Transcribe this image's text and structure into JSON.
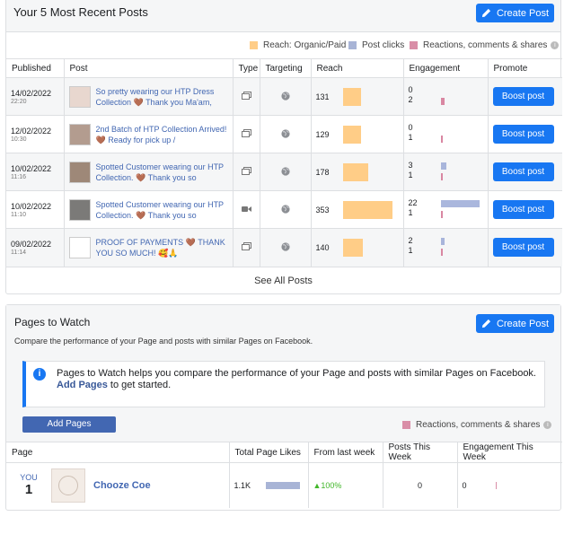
{
  "recent": {
    "title": "Your 5 Most Recent Posts",
    "create_post": "Create Post",
    "legend": [
      {
        "label": "Reach: Organic/Paid",
        "color": "#ffcd87"
      },
      {
        "label": "Post clicks",
        "color": "#a8b4d6"
      },
      {
        "label": "Reactions, comments & shares",
        "color": "#d98ea7"
      }
    ],
    "info_icon": "info-icon",
    "columns": [
      "Published",
      "Post",
      "Type",
      "Targeting",
      "Reach",
      "Engagement",
      "Promote"
    ],
    "rows": [
      {
        "date": "14/02/2022",
        "time": "22:20",
        "text": "So pretty wearing our HTP Dress Collection 🤎 Thank you Ma'am,",
        "type": "photo",
        "reach": "131",
        "reach_frac": 0.37,
        "eng1": "0",
        "eng2": "2",
        "eng1_frac": 0,
        "eng2_frac": 0.09,
        "boost": "Boost post"
      },
      {
        "date": "12/02/2022",
        "time": "10:30",
        "text": "2nd Batch of HTP Collection Arrived! 🤎 Ready for pick up /",
        "type": "photo",
        "reach": "129",
        "reach_frac": 0.37,
        "eng1": "0",
        "eng2": "1",
        "eng1_frac": 0,
        "eng2_frac": 0.045,
        "boost": "Boost post"
      },
      {
        "date": "10/02/2022",
        "time": "11:16",
        "text": "Spotted Customer wearing our HTP Collection. 🤎 Thank you so",
        "type": "photo",
        "reach": "178",
        "reach_frac": 0.5,
        "eng1": "3",
        "eng2": "1",
        "eng1_frac": 0.14,
        "eng2_frac": 0.045,
        "boost": "Boost post"
      },
      {
        "date": "10/02/2022",
        "time": "11:10",
        "text": "Spotted Customer wearing our HTP Collection. 🤎 Thank you so",
        "type": "video",
        "reach": "353",
        "reach_frac": 1.0,
        "eng1": "22",
        "eng2": "1",
        "eng1_frac": 1.0,
        "eng2_frac": 0.045,
        "boost": "Boost post"
      },
      {
        "date": "09/02/2022",
        "time": "11:14",
        "text": "PROOF OF PAYMENTS 🤎 THANK YOU SO MUCH! 🥰🙏",
        "type": "photo",
        "reach": "140",
        "reach_frac": 0.4,
        "eng1": "2",
        "eng2": "1",
        "eng1_frac": 0.09,
        "eng2_frac": 0.045,
        "boost": "Boost post"
      }
    ],
    "see_all": "See All Posts"
  },
  "watch": {
    "title": "Pages to Watch",
    "create_post": "Create Post",
    "subtitle": "Compare the performance of your Page and posts with similar Pages on Facebook.",
    "info_text": "Pages to Watch helps you compare the performance of your Page and posts with similar Pages on Facebook.",
    "info_link": "Add Pages",
    "info_suffix": " to get started.",
    "add_pages": "Add Pages",
    "legend": "Reactions, comments & shares",
    "columns": [
      "Page",
      "Total Page Likes",
      "From last week",
      "Posts This Week",
      "Engagement This Week"
    ],
    "row": {
      "you": "YOU",
      "rank": "1",
      "name": "Chooze Coe",
      "likes": "1.1K",
      "change": "▲100%",
      "posts": "0",
      "engagement": "0"
    }
  }
}
